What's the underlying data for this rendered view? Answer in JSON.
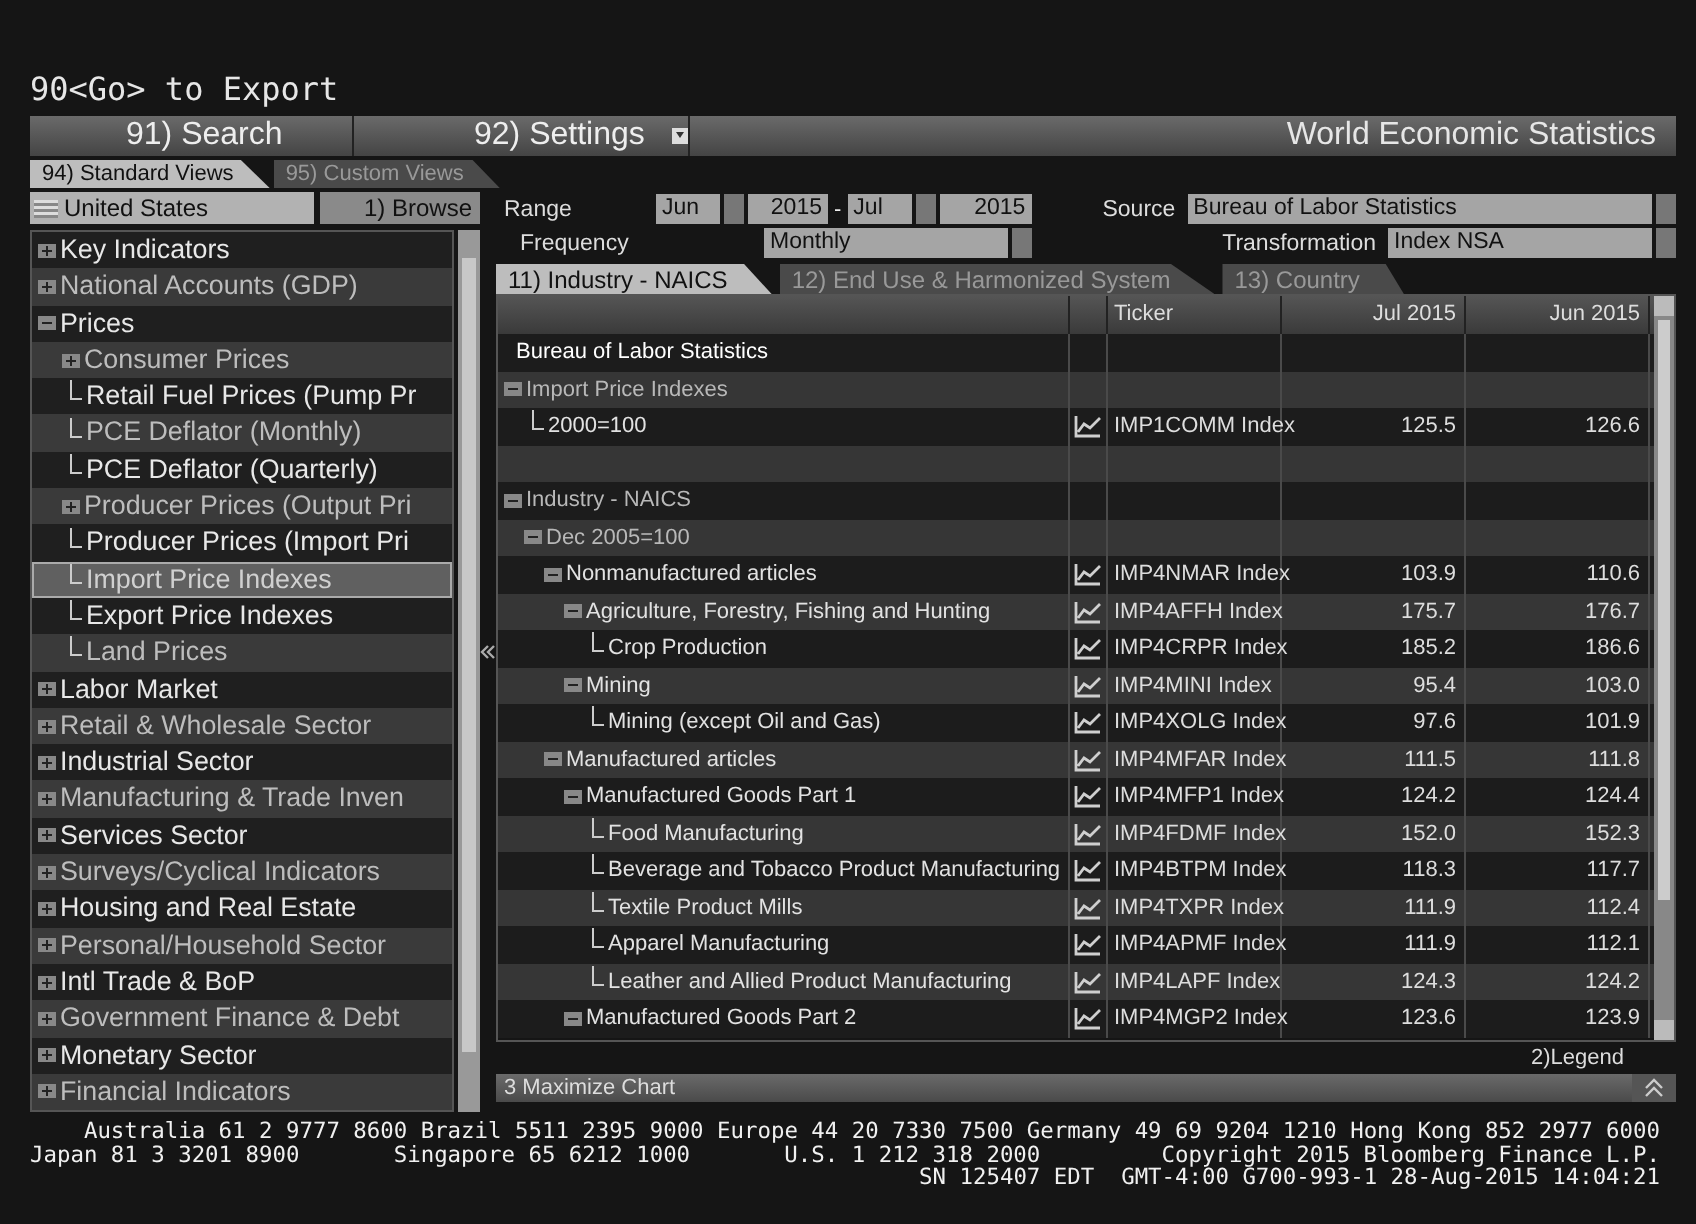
{
  "command_line": "90<Go> to Export",
  "menu": [
    {
      "label": "91) Search",
      "dropdown": false
    },
    {
      "label": "92) Settings",
      "dropdown": true
    }
  ],
  "app_title": "World Economic Statistics",
  "view_tabs": [
    {
      "label": "94) Standard Views",
      "selected": true
    },
    {
      "label": "95) Custom Views",
      "selected": false
    }
  ],
  "sidebar": {
    "country": "United States",
    "browse_button": "1) Browse",
    "items": [
      {
        "label": "Key Indicators",
        "expanded": false,
        "selected": false
      },
      {
        "label": "National Accounts (GDP)",
        "expanded": false,
        "selected": false
      },
      {
        "label": "Prices",
        "expanded": true,
        "selected": false,
        "children": [
          {
            "label": "Consumer Prices",
            "expanded": false,
            "selected": false
          },
          {
            "label": "Retail Fuel Prices (Pump Pr",
            "selected": false
          },
          {
            "label": "PCE Deflator (Monthly)",
            "selected": false
          },
          {
            "label": "PCE Deflator (Quarterly)",
            "selected": false
          },
          {
            "label": "Producer Prices (Output Pri",
            "expanded": false,
            "selected": false
          },
          {
            "label": "Producer Prices (Import Pri",
            "selected": false
          },
          {
            "label": "Import Price Indexes",
            "selected": true
          },
          {
            "label": "Export Price Indexes",
            "selected": false
          },
          {
            "label": "Land Prices",
            "selected": false
          }
        ]
      },
      {
        "label": "Labor Market",
        "expanded": false,
        "selected": false
      },
      {
        "label": "Retail & Wholesale Sector",
        "expanded": false,
        "selected": false
      },
      {
        "label": "Industrial Sector",
        "expanded": false,
        "selected": false
      },
      {
        "label": "Manufacturing & Trade Inven",
        "expanded": false,
        "selected": false
      },
      {
        "label": "Services Sector",
        "expanded": false,
        "selected": false
      },
      {
        "label": "Surveys/Cyclical Indicators",
        "expanded": false,
        "selected": false
      },
      {
        "label": "Housing and Real Estate",
        "expanded": false,
        "selected": false
      },
      {
        "label": "Personal/Household Sector",
        "expanded": false,
        "selected": false
      },
      {
        "label": "Intl Trade & BoP",
        "expanded": false,
        "selected": false
      },
      {
        "label": "Government Finance & Debt",
        "expanded": false,
        "selected": false
      },
      {
        "label": "Monetary Sector",
        "expanded": false,
        "selected": false
      },
      {
        "label": "Financial Indicators",
        "expanded": false,
        "selected": false
      }
    ]
  },
  "filters": {
    "range_label": "Range",
    "range_start_month": "Jun",
    "range_start_year": "2015",
    "range_separator": "-",
    "range_end_month": "Jul",
    "range_end_year": "2015",
    "source_label": "Source",
    "source": "Bureau of Labor Statistics",
    "frequency_label": "Frequency",
    "frequency": "Monthly",
    "transformation_label": "Transformation",
    "transformation": "Index NSA"
  },
  "table_tabs": [
    {
      "label": "11) Industry - NAICS",
      "selected": true
    },
    {
      "label": "12) End Use & Harmonized System",
      "selected": false
    },
    {
      "label": "13) Country",
      "selected": false
    }
  ],
  "table": {
    "columns": [
      "Ticker",
      "Jul 2015",
      "Jun 2015"
    ],
    "rows": [
      {
        "kind": "source",
        "label": "Bureau of Labor Statistics"
      },
      {
        "kind": "group",
        "label": "Import Price Indexes",
        "expanded": true,
        "children": [
          {
            "kind": "series",
            "label": "2000=100",
            "ticker": "IMP1COMM Index",
            "jul": "125.5",
            "jun": "126.6"
          }
        ]
      },
      {
        "kind": "spacer"
      },
      {
        "kind": "group",
        "label": "Industry - NAICS",
        "expanded": true,
        "children": [
          {
            "kind": "group",
            "label": "Dec 2005=100",
            "expanded": true,
            "children": [
              {
                "kind": "series",
                "label": "Nonmanufactured articles",
                "expanded": true,
                "ticker": "IMP4NMAR Index",
                "jul": "103.9",
                "jun": "110.6",
                "children": [
                  {
                    "kind": "series",
                    "label": "Agriculture, Forestry, Fishing and Hunting",
                    "expanded": true,
                    "ticker": "IMP4AFFH Index",
                    "jul": "175.7",
                    "jun": "176.7",
                    "children": [
                      {
                        "kind": "series",
                        "label": "Crop Production",
                        "ticker": "IMP4CRPR Index",
                        "jul": "185.2",
                        "jun": "186.6"
                      }
                    ]
                  },
                  {
                    "kind": "series",
                    "label": "Mining",
                    "expanded": true,
                    "ticker": "IMP4MINI Index",
                    "jul": "95.4",
                    "jun": "103.0",
                    "children": [
                      {
                        "kind": "series",
                        "label": "Mining (except Oil and Gas)",
                        "ticker": "IMP4XOLG Index",
                        "jul": "97.6",
                        "jun": "101.9"
                      }
                    ]
                  }
                ]
              },
              {
                "kind": "series",
                "label": "Manufactured articles",
                "expanded": true,
                "ticker": "IMP4MFAR Index",
                "jul": "111.5",
                "jun": "111.8",
                "children": [
                  {
                    "kind": "series",
                    "label": "Manufactured Goods Part 1",
                    "expanded": true,
                    "ticker": "IMP4MFP1 Index",
                    "jul": "124.2",
                    "jun": "124.4",
                    "children": [
                      {
                        "kind": "series",
                        "label": "Food Manufacturing",
                        "ticker": "IMP4FDMF Index",
                        "jul": "152.0",
                        "jun": "152.3"
                      },
                      {
                        "kind": "series",
                        "label": "Beverage and Tobacco Product Manufacturing",
                        "ticker": "IMP4BTPM Index",
                        "jul": "118.3",
                        "jun": "117.7"
                      },
                      {
                        "kind": "series",
                        "label": "Textile Product Mills",
                        "ticker": "IMP4TXPR Index",
                        "jul": "111.9",
                        "jun": "112.4"
                      },
                      {
                        "kind": "series",
                        "label": "Apparel Manufacturing",
                        "ticker": "IMP4APMF Index",
                        "jul": "111.9",
                        "jun": "112.1"
                      },
                      {
                        "kind": "series",
                        "label": "Leather and Allied Product Manufacturing",
                        "ticker": "IMP4LAPF Index",
                        "jul": "124.3",
                        "jun": "124.2"
                      }
                    ]
                  },
                  {
                    "kind": "series",
                    "label": "Manufactured Goods Part 2",
                    "expanded": true,
                    "ticker": "IMP4MGP2 Index",
                    "jul": "123.6",
                    "jun": "123.9"
                  }
                ]
              }
            ]
          }
        ]
      }
    ]
  },
  "legend_button": "2)Legend",
  "maximize_bar": "3 Maximize Chart",
  "footer": [
    "Australia 61 2 9777 8600 Brazil 5511 2395 9000 Europe 44 20 7330 7500 Germany 49 69 9204 1210 Hong Kong 852 2977 6000",
    "Japan 81 3 3201 8900       Singapore 65 6212 1000       U.S. 1 212 318 2000         Copyright 2015 Bloomberg Finance L.P.",
    "SN 125407 EDT  GMT-4:00 G700-993-1 28-Aug-2015 14:04:21"
  ]
}
